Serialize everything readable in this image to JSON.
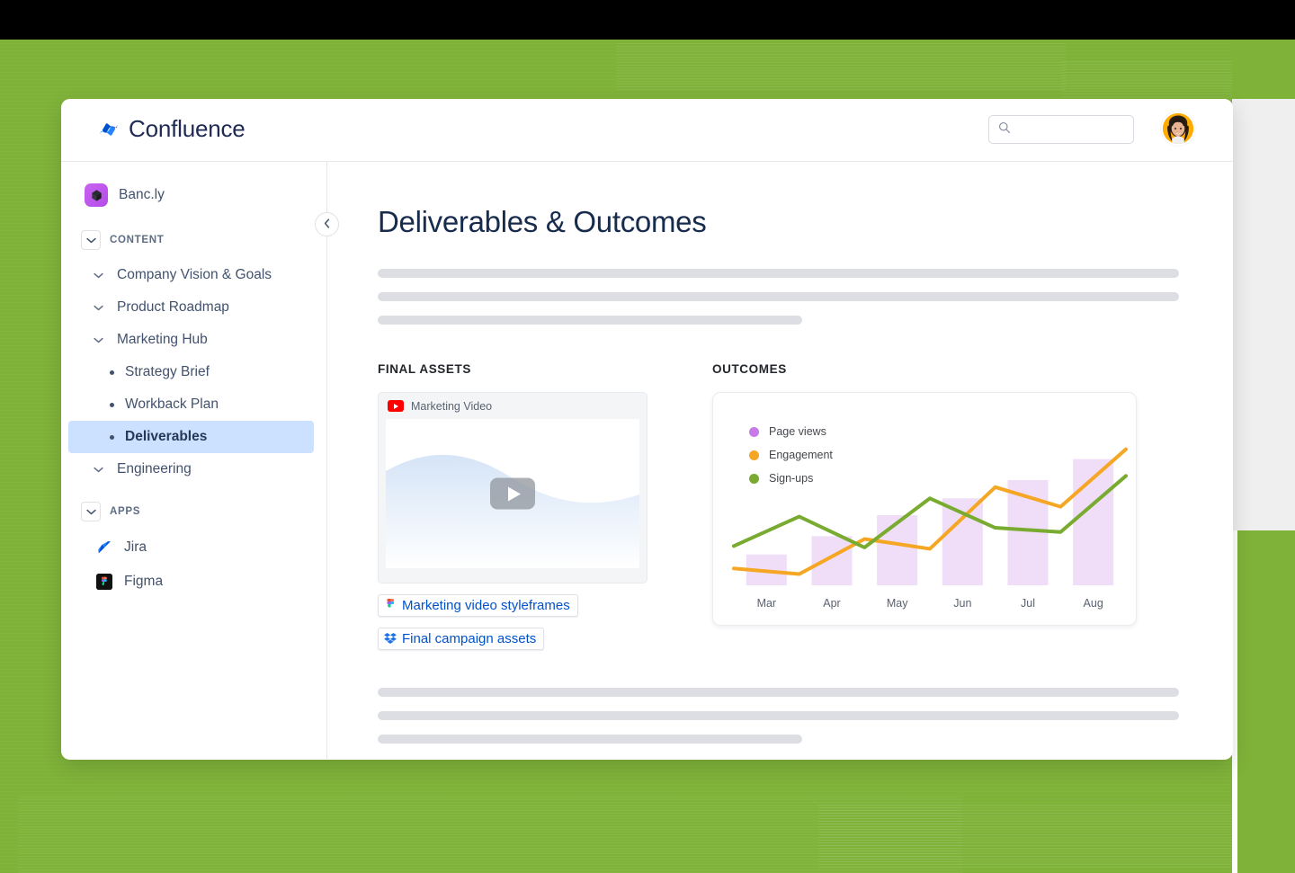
{
  "app": {
    "name": "Confluence",
    "logo_icon": "confluence-logo-icon"
  },
  "topbar": {
    "search_placeholder": "",
    "search_value": "",
    "search_icon": "search-icon",
    "avatar_label": "User avatar"
  },
  "sidebar": {
    "space": {
      "name": "Banc.ly",
      "icon": "bancly-space-icon"
    },
    "sections": [
      {
        "label": "CONTENT",
        "items": [
          {
            "label": "Company Vision & Goals",
            "type": "expandable",
            "selected": false
          },
          {
            "label": "Product Roadmap",
            "type": "expandable",
            "selected": false
          },
          {
            "label": "Marketing Hub",
            "type": "expandable",
            "selected": false
          },
          {
            "label": "Strategy Brief",
            "type": "child",
            "selected": false
          },
          {
            "label": "Workback Plan",
            "type": "child",
            "selected": false
          },
          {
            "label": "Deliverables",
            "type": "child",
            "selected": true
          },
          {
            "label": "Engineering",
            "type": "expandable",
            "selected": false
          }
        ]
      },
      {
        "label": "APPS",
        "items": [
          {
            "label": "Jira",
            "type": "app",
            "icon": "jira-icon"
          },
          {
            "label": "Figma",
            "type": "app",
            "icon": "figma-icon"
          }
        ]
      }
    ],
    "collapse_button_icon": "chevron-left-icon"
  },
  "content": {
    "title": "Deliverables & Outcomes",
    "top_skeleton_widths": [
      "100%",
      "100%",
      "53%"
    ],
    "bottom_skeleton_widths": [
      "100%",
      "100%",
      "53%"
    ],
    "final_assets": {
      "heading": "FINAL ASSETS",
      "video": {
        "title": "Marketing Video",
        "source_icon": "youtube-icon",
        "play_icon": "play-icon"
      },
      "links": [
        {
          "label": "Marketing video styleframes",
          "icon": "figma-icon"
        },
        {
          "label": "Final campaign assets",
          "icon": "dropbox-icon"
        }
      ]
    },
    "outcomes": {
      "heading": "OUTCOMES"
    }
  },
  "colors": {
    "brand_blue": "#0052cc",
    "page_green": "#7fb239",
    "selected_nav": "#cce0ff",
    "page_views_purple": "#c77ae8",
    "engagement_orange": "#f5a623",
    "signups_green": "#78ab2f",
    "bar_fill": "#f0ddf7",
    "title_navy": "#172b4d"
  },
  "chart_data": {
    "type": "bar",
    "title": "",
    "xlabel": "",
    "ylabel": "",
    "categories": [
      "Mar",
      "Apr",
      "May",
      "Jun",
      "Jul",
      "Aug"
    ],
    "ylim": [
      0,
      100
    ],
    "grid": false,
    "legend_position": "top-left",
    "series": [
      {
        "name": "Page views",
        "type": "bar",
        "color": "#f0ddf7",
        "values": [
          22,
          35,
          50,
          62,
          75,
          90
        ]
      },
      {
        "name": "Engagement",
        "type": "line",
        "color": "#f5a623",
        "values": [
          12,
          8,
          33,
          26,
          70,
          56,
          97
        ]
      },
      {
        "name": "Sign-ups",
        "type": "line",
        "color": "#78ab2f",
        "values": [
          28,
          49,
          27,
          62,
          41,
          38,
          78
        ]
      }
    ]
  }
}
